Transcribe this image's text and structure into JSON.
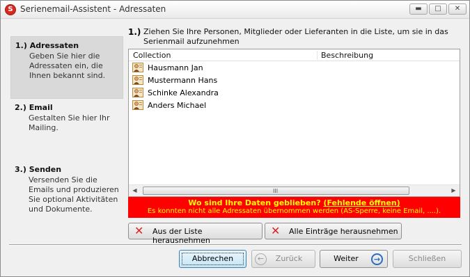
{
  "window": {
    "title": "Serienemail-Assistent - Adressaten",
    "controls": {
      "minimize": "▬",
      "maximize": "□",
      "close": "✕"
    }
  },
  "steps": [
    {
      "title": "1.) Adressaten",
      "desc": "Geben Sie hier die Adressaten ein, die Ihnen bekannt sind.",
      "active": true
    },
    {
      "title": "2.) Email",
      "desc": "Gestalten Sie hier Ihr Mailing.",
      "active": false
    },
    {
      "title": "3.) Senden",
      "desc": "Versenden Sie die Emails und produzieren Sie optional Aktivitäten und Dokumente.",
      "active": false
    }
  ],
  "content": {
    "number": "1.)",
    "instruction": "Ziehen Sie Ihre Personen, Mitglieder oder Lieferanten in die Liste, um sie in das Serienmail aufzunehmen"
  },
  "list": {
    "columns": [
      "Collection",
      "Beschreibung"
    ],
    "rows": [
      {
        "name": "Hausmann Jan"
      },
      {
        "name": "Mustermann Hans"
      },
      {
        "name": "Schinke Alexandra"
      },
      {
        "name": "Anders Michael"
      }
    ],
    "scroll_grip": "III"
  },
  "warning": {
    "question": "Wo sind Ihre Daten geblieben?",
    "link": "(Fehlende öffnen)",
    "detail": "Es konnten nicht alle Adressaten übernommen werden (AS-Sperre, keine Email, ....).",
    "color": "#ff0000",
    "text_color": "#ffff00"
  },
  "actions": {
    "remove": "Aus der Liste herausnehmen",
    "remove_all": "Alle Einträge herausnehmen"
  },
  "nav": {
    "cancel": "Abbrechen",
    "back": "Zurück",
    "next": "Weiter",
    "close": "Schließen"
  }
}
